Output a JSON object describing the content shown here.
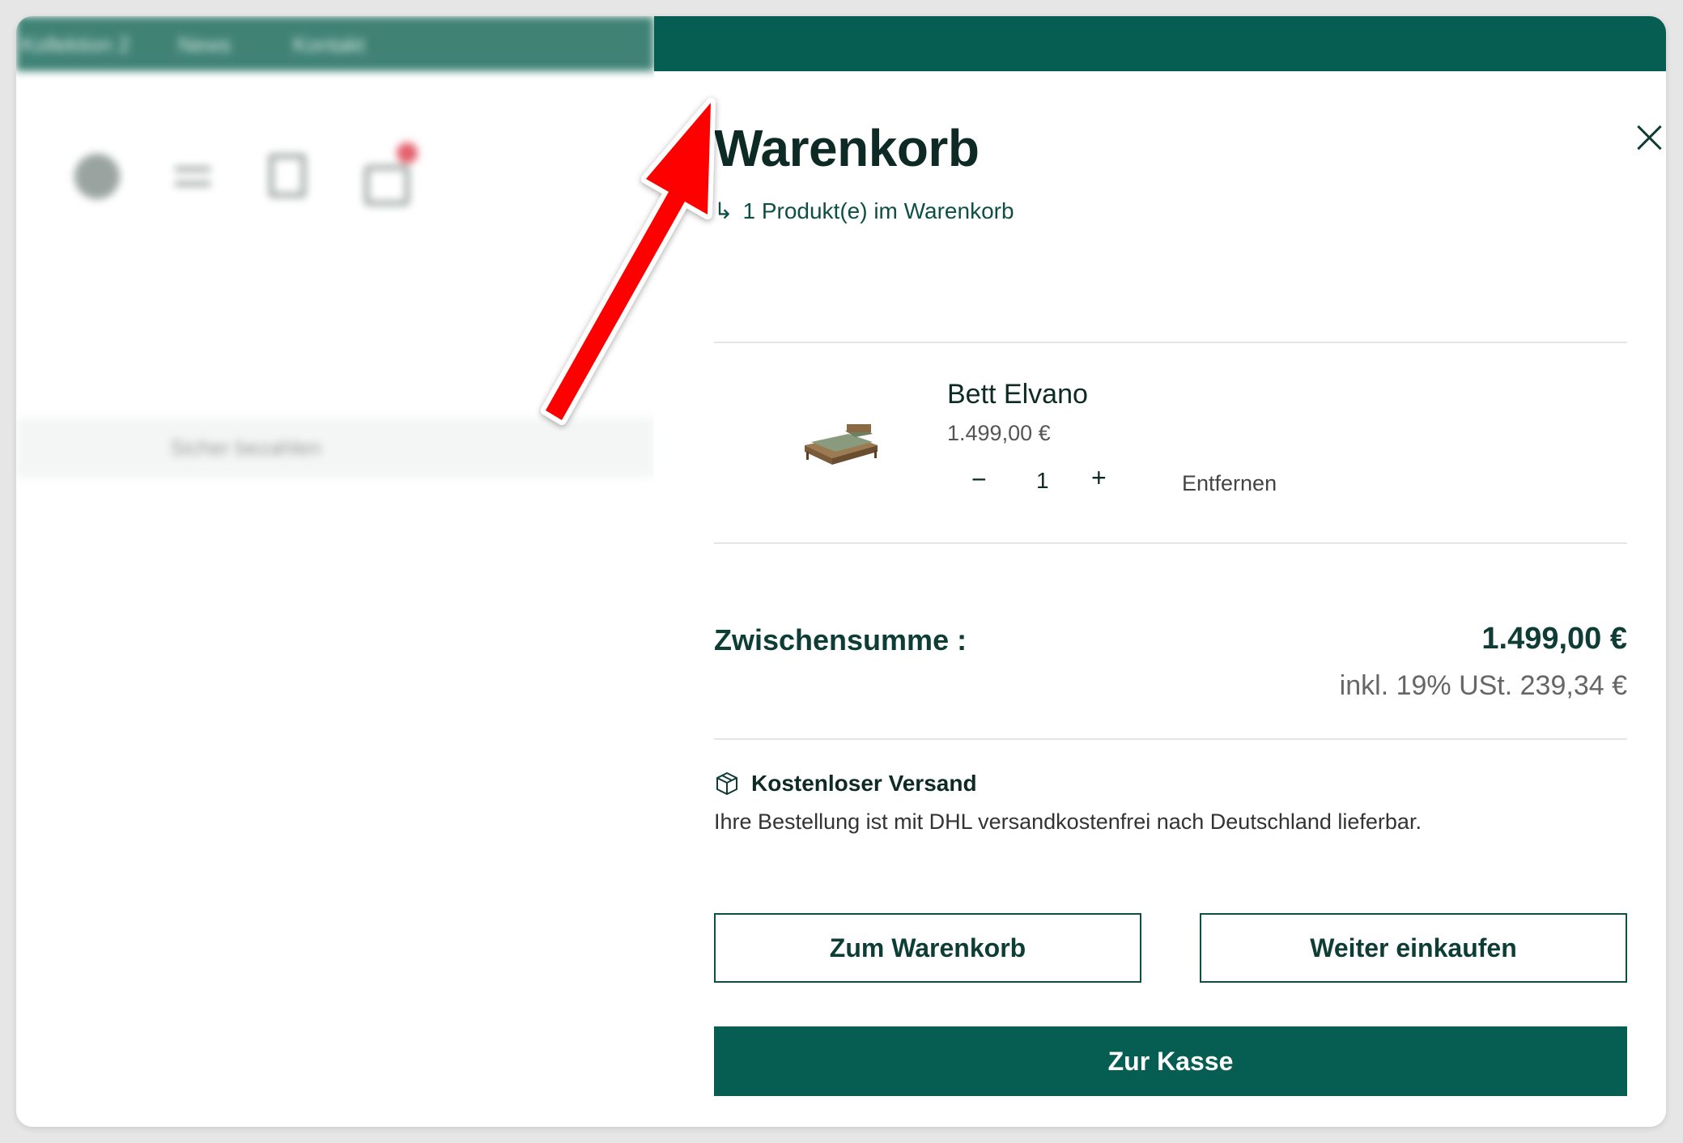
{
  "background_nav": {
    "items": [
      "Kollektion 2",
      "News",
      "Kontakt"
    ]
  },
  "background_page": {
    "secure_pay": "Sicher bezahlen"
  },
  "cart": {
    "title": "Warenkorb",
    "count_text": "1 Produkt(e) im Warenkorb",
    "item": {
      "name": "Bett Elvano",
      "price": "1.499,00 €",
      "quantity": "1",
      "remove_label": "Entfernen"
    },
    "subtotal_label": "Zwischensumme :",
    "subtotal_value": "1.499,00 €",
    "tax_note": "inkl. 19% USt. 239,34 €",
    "shipping_title": "Kostenloser Versand",
    "shipping_text": "Ihre Bestellung ist mit DHL versandkostenfrei nach Deutschland lieferbar.",
    "buttons": {
      "view_cart": "Zum Warenkorb",
      "continue_shopping": "Weiter einkaufen",
      "checkout": "Zur Kasse"
    }
  },
  "colors": {
    "brand_green": "#065e52",
    "arrow_red": "#ff0000"
  },
  "icons": [
    "close-icon",
    "return-arrow-icon",
    "bed-product-image",
    "box-icon",
    "minus-icon",
    "plus-icon"
  ]
}
